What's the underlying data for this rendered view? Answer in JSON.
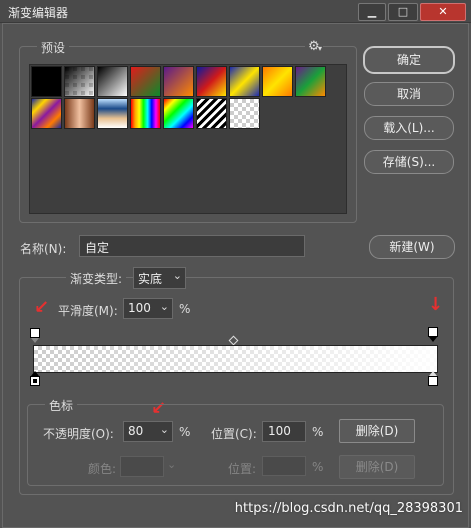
{
  "window": {
    "title": "渐变编辑器",
    "minimize": "▁",
    "maximize": "□",
    "close": "✕"
  },
  "presets": {
    "label": "预设",
    "settings_icon": "⚙",
    "swatches": [
      {
        "name": "black-solid",
        "css": "#000"
      },
      {
        "name": "black-to-transparent",
        "css": "checker-dark"
      },
      {
        "name": "black-white",
        "css": "linear-gradient(135deg,#000,#fff)"
      },
      {
        "name": "red-green",
        "css": "linear-gradient(135deg,#e21b1b,#0a8a2a)"
      },
      {
        "name": "violet-orange",
        "css": "linear-gradient(135deg,#5a1a8a,#ff8a00)"
      },
      {
        "name": "blue-red-yellow",
        "css": "linear-gradient(135deg,#0a1aa0,#d01a1a,#ffe400)"
      },
      {
        "name": "blue-yellow-blue",
        "css": "linear-gradient(135deg,#1a2ab0,#ffe400,#1a2ab0)"
      },
      {
        "name": "orange-yellow-orange",
        "css": "linear-gradient(135deg,#ff7a00,#ffe400,#ff7a00)"
      },
      {
        "name": "violet-green-orange",
        "css": "linear-gradient(135deg,#6a1a8a,#1aa03a,#ff8a00)"
      },
      {
        "name": "yellow-violet-orange-blue",
        "css": "linear-gradient(135deg,#1a2aa0,#ffd400,#8a1aa0,#ff7a00,#1a2aa0)"
      },
      {
        "name": "copper",
        "css": "linear-gradient(90deg,#7a3a1a,#f0c0a0,#7a3a1a)"
      },
      {
        "name": "chrome",
        "css": "linear-gradient(180deg,#bfe0ff,#1a4a8a,#e8c090,#fff)"
      },
      {
        "name": "spectrum",
        "css": "linear-gradient(90deg,red,orange,yellow,lime,cyan,blue,magenta,red)"
      },
      {
        "name": "transparent-rainbow",
        "css": "linear-gradient(135deg,red,yellow,lime,cyan,blue,magenta)"
      },
      {
        "name": "transparent-stripes",
        "css": "repeating-linear-gradient(135deg,#000 0 3px,#fff 3px 6px)"
      },
      {
        "name": "transparent",
        "css": "checker"
      }
    ]
  },
  "buttons": {
    "ok": "确定",
    "cancel": "取消",
    "load": "载入(L)...",
    "save": "存储(S)...",
    "new": "新建(W)"
  },
  "name_field": {
    "label": "名称(N):",
    "value": "自定"
  },
  "gradient": {
    "type_label": "渐变类型:",
    "type_value": "实底",
    "smoothness_label": "平滑度(M):",
    "smoothness_value": "100",
    "percent": "%"
  },
  "stops": {
    "label": "色标",
    "opacity_label": "不透明度(O):",
    "opacity_value": "80",
    "opacity_unit": "%",
    "location_label": "位置(C):",
    "location_value": "100",
    "location_unit": "%",
    "delete_label": "删除(D)",
    "color_label": "颜色:",
    "color_location_label": "位置:",
    "color_location_unit": "%",
    "color_delete_label": "删除(D)"
  },
  "watermark": "https://blog.csdn.net/qq_28398301"
}
